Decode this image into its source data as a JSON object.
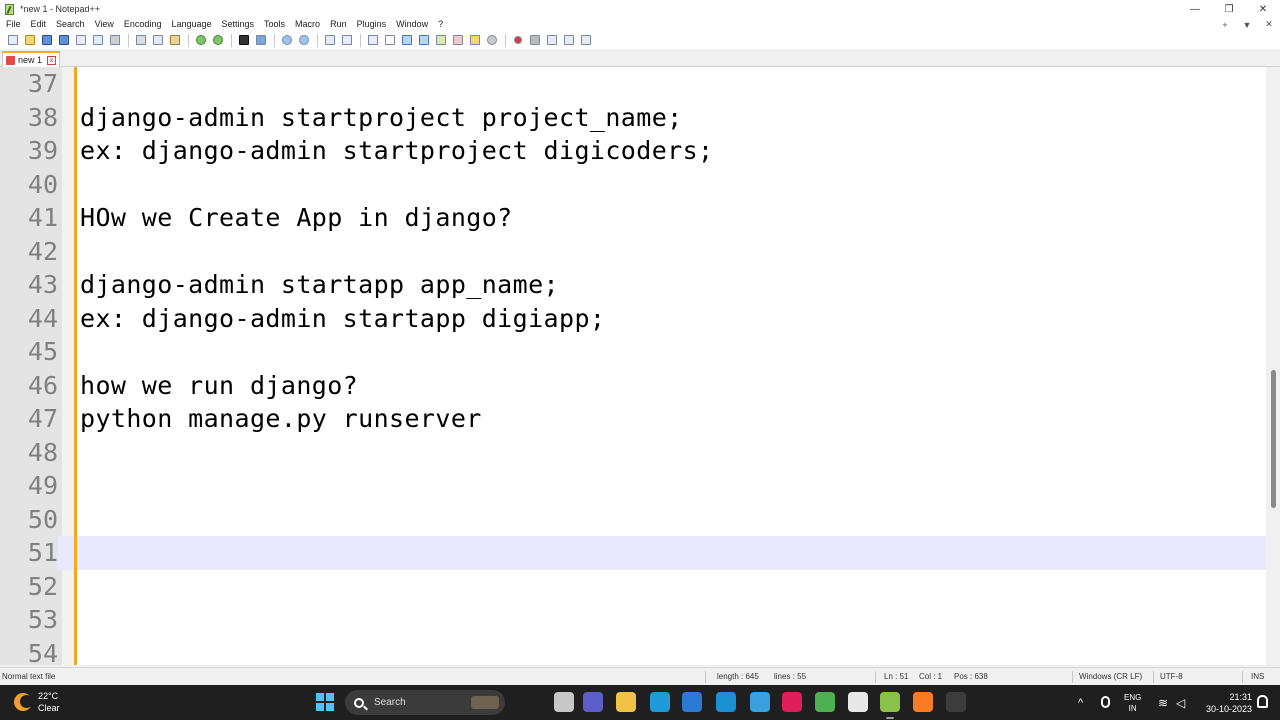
{
  "window": {
    "title": "*new 1 - Notepad++",
    "controls": [
      "—",
      "❐",
      "✕"
    ]
  },
  "menu": {
    "items": [
      "File",
      "Edit",
      "Search",
      "View",
      "Encoding",
      "Language",
      "Settings",
      "Tools",
      "Macro",
      "Run",
      "Plugins",
      "Window",
      "?"
    ],
    "right": [
      "+",
      "▼",
      "✕"
    ]
  },
  "tab": {
    "label": "new 1"
  },
  "editor": {
    "current_line": 51,
    "lines": [
      {
        "num": "37",
        "text": ""
      },
      {
        "num": "38",
        "text": "django-admin startproject project_name;"
      },
      {
        "num": "39",
        "text": "ex: django-admin startproject digicoders;"
      },
      {
        "num": "40",
        "text": ""
      },
      {
        "num": "41",
        "text": "HOw we Create App in django?"
      },
      {
        "num": "42",
        "text": ""
      },
      {
        "num": "43",
        "text": "django-admin startapp app_name;"
      },
      {
        "num": "44",
        "text": "ex: django-admin startapp digiapp;"
      },
      {
        "num": "45",
        "text": ""
      },
      {
        "num": "46",
        "text": "how we run django?"
      },
      {
        "num": "47",
        "text": "python manage.py runserver"
      },
      {
        "num": "48",
        "text": ""
      },
      {
        "num": "49",
        "text": ""
      },
      {
        "num": "50",
        "text": ""
      },
      {
        "num": "51",
        "text": ""
      },
      {
        "num": "52",
        "text": ""
      },
      {
        "num": "53",
        "text": ""
      },
      {
        "num": "54",
        "text": ""
      }
    ]
  },
  "statusbar": {
    "file_type": "Normal text file",
    "length": "length : 645",
    "lines": "lines : 55",
    "ln": "Ln : 51",
    "col": "Col : 1",
    "pos": "Pos : 638",
    "eol": "Windows (CR LF)",
    "encoding": "UTF-8",
    "mode": "INS"
  },
  "taskbar": {
    "weather_temp": "22°C",
    "weather_desc": "Clear",
    "search_label": "Search",
    "lang_line1": "ENG",
    "lang_line2": "IN",
    "time": "21:31",
    "date": "30-10-2023",
    "apps": [
      {
        "name": "task-view-icon",
        "color": "#c7c7c7"
      },
      {
        "name": "teams-icon",
        "color": "#5b5fc7"
      },
      {
        "name": "file-explorer-icon",
        "color": "#f2c244"
      },
      {
        "name": "edge-icon",
        "color": "#1f9bd7"
      },
      {
        "name": "store-icon",
        "color": "#2b7bd6"
      },
      {
        "name": "mysql-icon",
        "color": "#1a8fd1"
      },
      {
        "name": "ie-icon",
        "color": "#3aa0e0"
      },
      {
        "name": "slack-icon",
        "color": "#e01e5a"
      },
      {
        "name": "chrome-icon",
        "color": "#4caf50"
      },
      {
        "name": "github-icon",
        "color": "#e8e8e8"
      },
      {
        "name": "notepadpp-icon",
        "color": "#8bc34a"
      },
      {
        "name": "xampp-icon",
        "color": "#fb7a24"
      },
      {
        "name": "terminal-icon",
        "color": "#3c3c3c"
      }
    ]
  }
}
